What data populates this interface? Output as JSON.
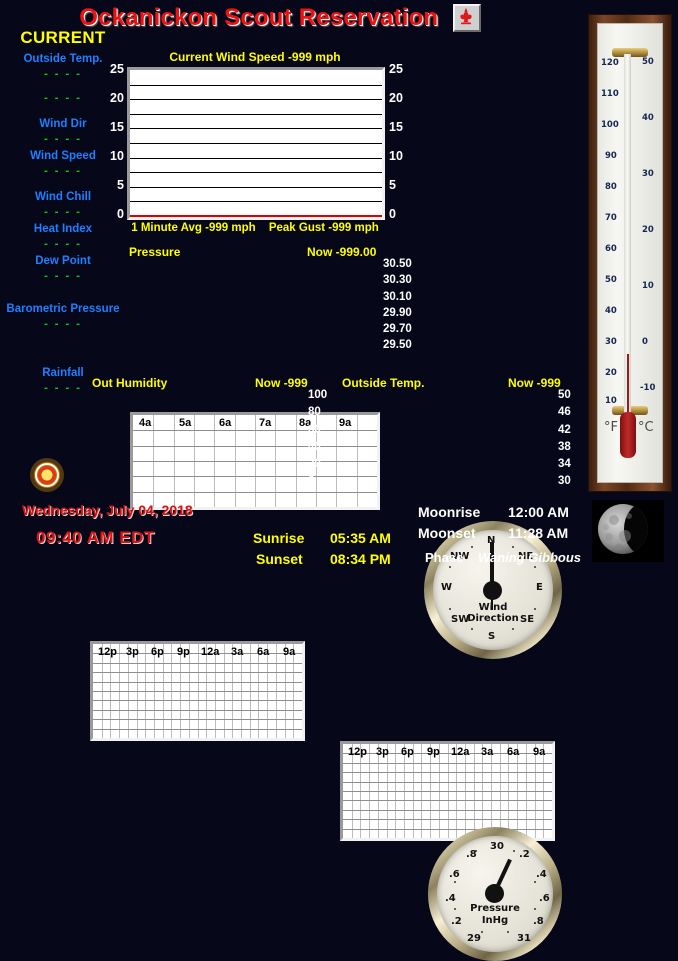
{
  "header": {
    "title": "Ockanickon Scout Reservation",
    "badge_icon": "scout-fleur-de-lis-icon"
  },
  "sidebar": {
    "heading": "CURRENT",
    "items": [
      {
        "label": "Outside Temp.",
        "value": "- - - -"
      },
      {
        "label": "",
        "value": "- - - -"
      },
      {
        "label": "Wind Dir",
        "value": "- - - -"
      },
      {
        "label": "Wind Speed",
        "value": "- - - -"
      },
      {
        "label": "Wind Chill",
        "value": "- - - -"
      },
      {
        "label": "Heat Index",
        "value": "- - - -"
      },
      {
        "label": "Dew Point",
        "value": "- - - -"
      },
      {
        "label": "Barometric Pressure",
        "value": "- - - -"
      },
      {
        "label": "Rainfall",
        "value": "- - - -"
      }
    ],
    "sun_icon": "sun-icon"
  },
  "chart_data": [
    {
      "id": "wind_speed",
      "type": "line",
      "title": "Current Wind Speed -999 mph",
      "current_value": "-999",
      "unit": "mph",
      "ylim": [
        0,
        25
      ],
      "yticks": [
        "0",
        "5",
        "10",
        "15",
        "20",
        "25"
      ],
      "yticks_right": [
        "0",
        "5",
        "10",
        "15",
        "20",
        "25"
      ],
      "x": [],
      "values": [],
      "grid": true,
      "footer_left": "1 Minute Avg -999 mph",
      "footer_right": "Peak Gust -999 mph"
    },
    {
      "id": "pressure",
      "type": "line",
      "title": "Pressure",
      "now_label": "Now -999.00",
      "xticks": [
        "4a",
        "5a",
        "6a",
        "7a",
        "8a",
        "9a"
      ],
      "ylim": [
        29.5,
        30.5
      ],
      "yticks": [
        "30.50",
        "30.30",
        "30.10",
        "29.90",
        "29.70",
        "29.50"
      ],
      "values": [],
      "grid": true
    },
    {
      "id": "out_humidity",
      "type": "line",
      "title": "Out Humidity",
      "now_label": "Now -999",
      "xticks": [
        "12p",
        "3p",
        "6p",
        "9p",
        "12a",
        "3a",
        "6a",
        "9a"
      ],
      "ylim": [
        0,
        100
      ],
      "yticks": [
        "100",
        "80",
        "60",
        "40",
        "20",
        "0"
      ],
      "values": [],
      "grid": true
    },
    {
      "id": "outside_temp",
      "type": "line",
      "title": "Outside Temp.",
      "now_label": "Now -999",
      "xticks": [
        "12p",
        "3p",
        "6p",
        "9p",
        "12a",
        "3a",
        "6a",
        "9a"
      ],
      "ylim": [
        30,
        50
      ],
      "yticks": [
        "50",
        "46",
        "42",
        "38",
        "34",
        "30"
      ],
      "values": [],
      "grid": true
    }
  ],
  "wind_gauge": {
    "center_line1": "Wind",
    "center_line2": "Direction",
    "labels": [
      "N",
      "NE",
      "E",
      "SE",
      "S",
      "SW",
      "W",
      "NW"
    ],
    "needle_heading_deg": 0
  },
  "pressure_gauge": {
    "center_line1": "Pressure",
    "center_line2": "InHg",
    "labels": [
      ".2",
      ".4",
      ".6",
      ".8",
      "29",
      "30",
      "31",
      ".2",
      ".4",
      ".6",
      ".8"
    ],
    "range_low": "29",
    "range_mid": "30",
    "range_high": "31"
  },
  "thermometer": {
    "unit_f": "°F",
    "unit_c": "°C",
    "f_scale": [
      "120",
      "110",
      "100",
      "90",
      "80",
      "70",
      "60",
      "50",
      "40",
      "30",
      "20",
      "10"
    ],
    "c_scale": [
      "50",
      "40",
      "30",
      "20",
      "10",
      "0",
      "-10"
    ]
  },
  "footer": {
    "date": "Wednesday, July 04, 2018",
    "time": "09:40 AM  EDT",
    "sunrise_label": "Sunrise",
    "sunrise_value": "05:35 AM",
    "sunset_label": "Sunset",
    "sunset_value": "08:34 PM",
    "moonrise_label": "Moonrise",
    "moonrise_value": "12:00 AM",
    "moonset_label": "Moonset",
    "moonset_value": "11:28 AM",
    "phase_label": "Phase",
    "phase_value": "Waning Gibbous",
    "moon_icon": "moon-waning-gibbous-icon"
  },
  "colors": {
    "background": "#07071a",
    "title_red": "#ee1111",
    "label_blue": "#1f7ffe",
    "value_green": "#00e000",
    "accent_yellow": "#ffff00"
  }
}
